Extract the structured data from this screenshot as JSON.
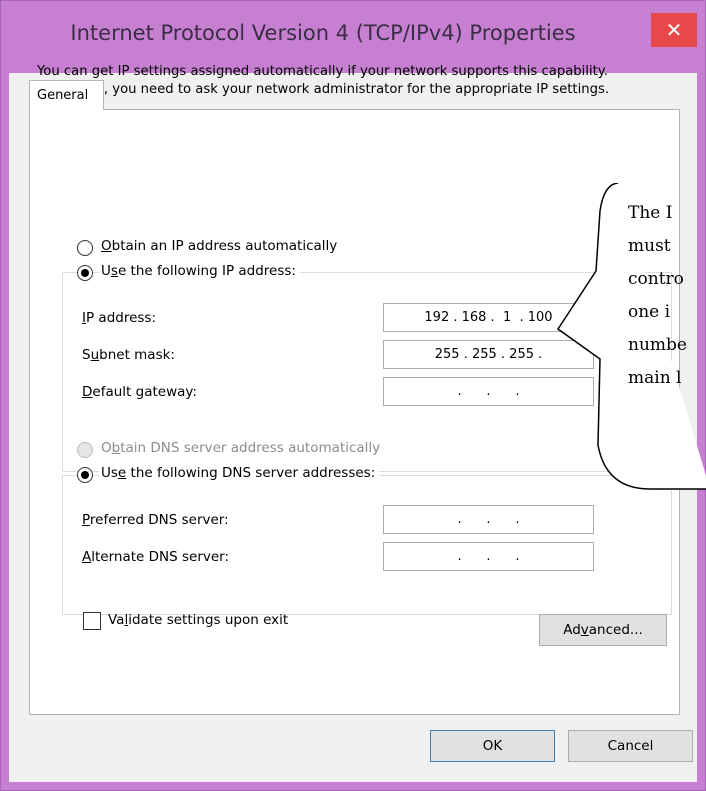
{
  "window": {
    "title": "Internet Protocol Version 4 (TCP/IPv4) Properties",
    "close_glyph": "✕"
  },
  "tabs": [
    {
      "label": "General"
    }
  ],
  "intro_text": "You can get IP settings assigned automatically if your network supports this capability. Otherwise, you need to ask your network administrator for the appropriate IP settings.",
  "ip_section": {
    "auto_option": {
      "pre": "",
      "mnemonic": "O",
      "post": "btain an IP address automatically",
      "selected": false
    },
    "manual_option": {
      "pre": "U",
      "mnemonic": "s",
      "post": "e the following IP address:",
      "selected": true
    },
    "fields": [
      {
        "label_pre": "",
        "mnemonic": "I",
        "label_post": "P address:",
        "value": "192 . 168 .  1  . 100"
      },
      {
        "label_pre": "S",
        "mnemonic": "u",
        "label_post": "bnet mask:",
        "value": "255 . 255 . 255 ."
      },
      {
        "label_pre": "",
        "mnemonic": "D",
        "label_post": "efault gateway:",
        "value": ".      .      ."
      }
    ]
  },
  "dns_section": {
    "auto_option": {
      "pre": "O",
      "mnemonic": "b",
      "post": "tain DNS server address automatically",
      "selected": false,
      "disabled": true
    },
    "manual_option": {
      "pre": "Us",
      "mnemonic": "e",
      "post": " the following DNS server addresses:",
      "selected": true
    },
    "fields": [
      {
        "label_pre": "",
        "mnemonic": "P",
        "label_post": "referred DNS server:",
        "value": ".      .      ."
      },
      {
        "label_pre": "",
        "mnemonic": "A",
        "label_post": "lternate DNS server:",
        "value": ".      .      ."
      }
    ]
  },
  "validate": {
    "pre": "Va",
    "mnemonic": "l",
    "post": "idate settings upon exit",
    "checked": false
  },
  "buttons": {
    "advanced": {
      "pre": "Ad",
      "mnemonic": "v",
      "post": "anced..."
    },
    "ok": "OK",
    "cancel": "Cancel"
  },
  "callout_lines": [
    "The I",
    "must",
    "contro",
    "one i",
    "numbe",
    "main l"
  ],
  "colors": {
    "frame": "#c67fd1",
    "close": "#e8484a",
    "default_button_border": "#3c7fb1"
  }
}
